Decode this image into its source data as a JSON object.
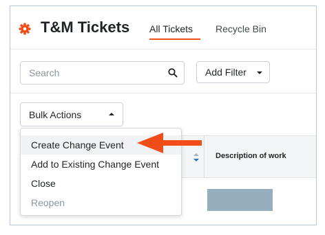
{
  "header": {
    "title": "T&M Tickets",
    "tabs": [
      {
        "label": "All Tickets",
        "active": true
      },
      {
        "label": "Recycle Bin",
        "active": false
      }
    ],
    "icon": "gear-icon",
    "accent_color": "#f04d18"
  },
  "toolbar": {
    "search_placeholder": "Search",
    "search_value": "",
    "add_filter_label": "Add Filter",
    "bulk_actions_label": "Bulk Actions"
  },
  "table": {
    "columns": [
      "Description of work"
    ]
  },
  "bulk_menu": {
    "items": [
      {
        "label": "Create Change Event",
        "disabled": false,
        "highlighted": true
      },
      {
        "label": "Add to Existing Change Event",
        "disabled": false,
        "highlighted": false
      },
      {
        "label": "Close",
        "disabled": false,
        "highlighted": false
      },
      {
        "label": "Reopen",
        "disabled": true,
        "highlighted": false
      }
    ]
  },
  "annotation": {
    "arrow_color": "#f04d18",
    "points_to": "Create Change Event"
  }
}
